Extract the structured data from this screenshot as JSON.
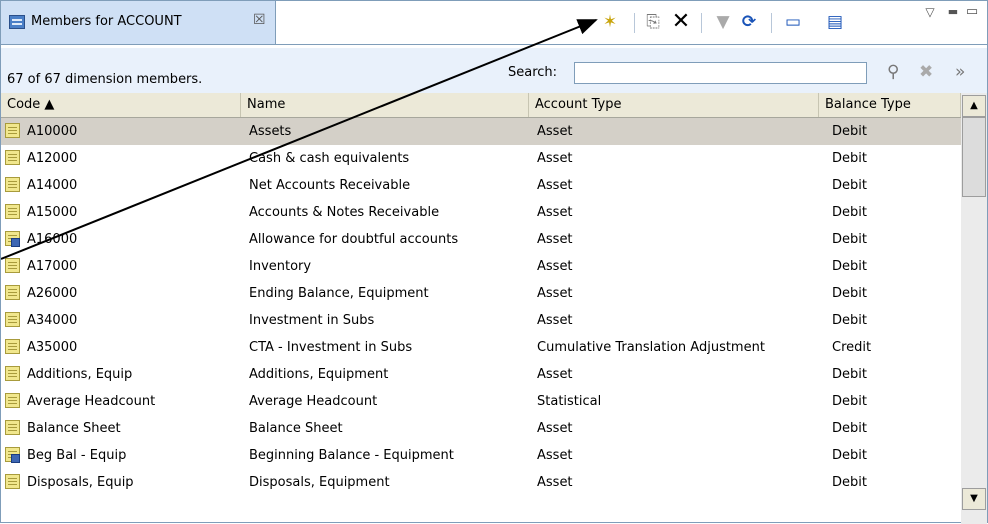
{
  "tab": {
    "title": "Members for ACCOUNT",
    "close": "☒"
  },
  "toolbar": {
    "new_member": "✶",
    "copy": "⎘",
    "delete": "✕",
    "filter": "▼",
    "refresh": "⟳",
    "properties": "▭",
    "layout": "▤",
    "menu": "▽",
    "minimize": "▬",
    "maximize": "▭"
  },
  "info": {
    "count": "67 of 67 dimension members.",
    "search_label": "Search:",
    "search_value": "",
    "search_icon": "⚲",
    "clear_icon": "✖",
    "expand_icon": "»"
  },
  "columns": [
    "Code ▲",
    "Name",
    "Account Type",
    "Balance Type"
  ],
  "rows": [
    {
      "code": "A10000",
      "name": "Assets",
      "type": "Asset",
      "balance": "Debit",
      "icon": "member"
    },
    {
      "code": "A12000",
      "name": "Cash & cash equivalents",
      "type": "Asset",
      "balance": "Debit",
      "icon": "member"
    },
    {
      "code": "A14000",
      "name": "Net Accounts Receivable",
      "type": "Asset",
      "balance": "Debit",
      "icon": "member"
    },
    {
      "code": "A15000",
      "name": "Accounts & Notes Receivable",
      "type": "Asset",
      "balance": "Debit",
      "icon": "member"
    },
    {
      "code": "A16000",
      "name": "Allowance for doubtful accounts",
      "type": "Asset",
      "balance": "Debit",
      "icon": "formula"
    },
    {
      "code": "A17000",
      "name": "Inventory",
      "type": "Asset",
      "balance": "Debit",
      "icon": "member"
    },
    {
      "code": "A26000",
      "name": "Ending Balance, Equipment",
      "type": "Asset",
      "balance": "Debit",
      "icon": "member"
    },
    {
      "code": "A34000",
      "name": "Investment in Subs",
      "type": "Asset",
      "balance": "Debit",
      "icon": "member"
    },
    {
      "code": "A35000",
      "name": "CTA - Investment in Subs",
      "type": "Cumulative Translation Adjustment",
      "balance": "Credit",
      "icon": "member"
    },
    {
      "code": "Additions, Equip",
      "name": "Additions, Equipment",
      "type": "Asset",
      "balance": "Debit",
      "icon": "member"
    },
    {
      "code": "Average Headcount",
      "name": "Average Headcount",
      "type": "Statistical",
      "balance": "Debit",
      "icon": "member"
    },
    {
      "code": "Balance Sheet",
      "name": "Balance Sheet",
      "type": "Asset",
      "balance": "Debit",
      "icon": "member"
    },
    {
      "code": "Beg Bal - Equip",
      "name": "Beginning Balance - Equipment",
      "type": "Asset",
      "balance": "Debit",
      "icon": "formula"
    },
    {
      "code": "Disposals, Equip",
      "name": "Disposals, Equipment",
      "type": "Asset",
      "balance": "Debit",
      "icon": "member"
    }
  ],
  "selected_row": 0,
  "colors": {
    "tab_bg": "#cfe0f5",
    "info_bg": "#e9f1fb",
    "header_bg": "#ece9d8",
    "selected_row": "#d4d0c8",
    "icon_yellow": "#f1e78d",
    "border": "#7f9db9"
  }
}
